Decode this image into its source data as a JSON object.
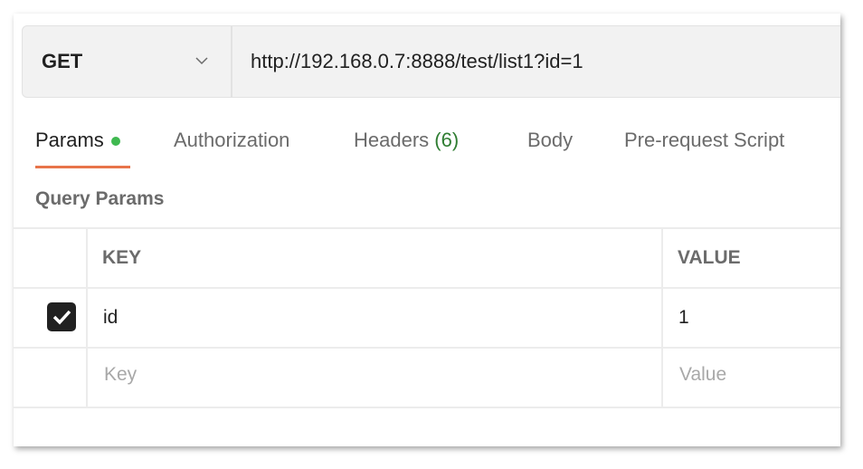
{
  "request": {
    "method": "GET",
    "url": "http://192.168.0.7:8888/test/list1?id=1"
  },
  "tabs": [
    {
      "label": "Params",
      "active": true,
      "indicator": "green-dot"
    },
    {
      "label": "Authorization"
    },
    {
      "label": "Headers",
      "count": "(6)"
    },
    {
      "label": "Body"
    },
    {
      "label": "Pre-request Script"
    }
  ],
  "colors": {
    "accent": "#e8744a",
    "indicator": "#3fb950",
    "count": "#2f7d32"
  },
  "query_params": {
    "title": "Query Params",
    "columns": [
      "KEY",
      "VALUE"
    ],
    "rows": [
      {
        "checked": true,
        "key": "id",
        "value": "1"
      }
    ],
    "new_row": {
      "key_placeholder": "Key",
      "value_placeholder": "Value"
    }
  }
}
